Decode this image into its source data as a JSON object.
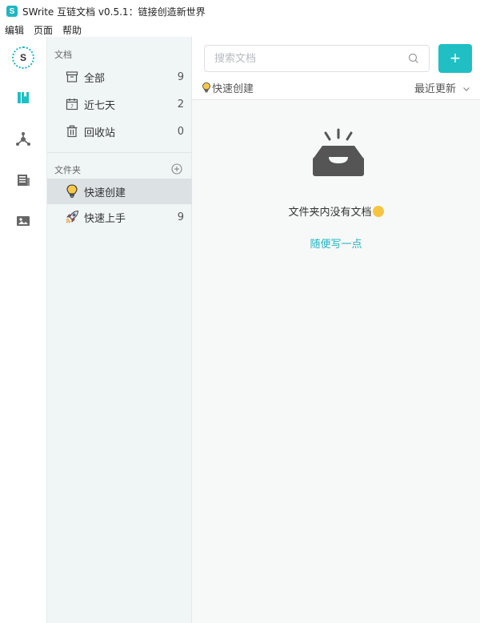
{
  "window": {
    "logo_letter": "S",
    "title": "SWrite 互链文档 v0.5.1：链接创造新世界"
  },
  "menu": [
    "编辑",
    "页面",
    "帮助"
  ],
  "rail": {
    "logo_letter": "S",
    "items": [
      {
        "icon": "book-icon",
        "active": true
      },
      {
        "icon": "graph-icon",
        "active": false
      },
      {
        "icon": "newspaper-icon",
        "active": false
      },
      {
        "icon": "image-icon",
        "active": false
      }
    ]
  },
  "sidebar": {
    "docs_section": "文档",
    "doc_items": [
      {
        "label": "全部",
        "count": "9",
        "icon": "archive-icon"
      },
      {
        "label": "近七天",
        "count": "2",
        "icon": "calendar-icon"
      },
      {
        "label": "回收站",
        "count": "0",
        "icon": "trash-icon"
      }
    ],
    "folders_section": "文件夹",
    "folder_items": [
      {
        "label": "快速创建",
        "count": "",
        "icon": "lightbulb-icon",
        "active": true
      },
      {
        "label": "快速上手",
        "count": "9",
        "icon": "rocket-icon",
        "active": false
      }
    ]
  },
  "main": {
    "search_placeholder": "搜索文档",
    "add_label": "+",
    "current_folder": "快速创建",
    "sort_label": "最近更新",
    "empty_text": "文件夹内没有文档",
    "write_link": "随便写一点"
  },
  "colors": {
    "accent": "#1fbfc4",
    "sidebar_bg": "#f0f5f5",
    "active_item_bg": "#dce1e4"
  }
}
